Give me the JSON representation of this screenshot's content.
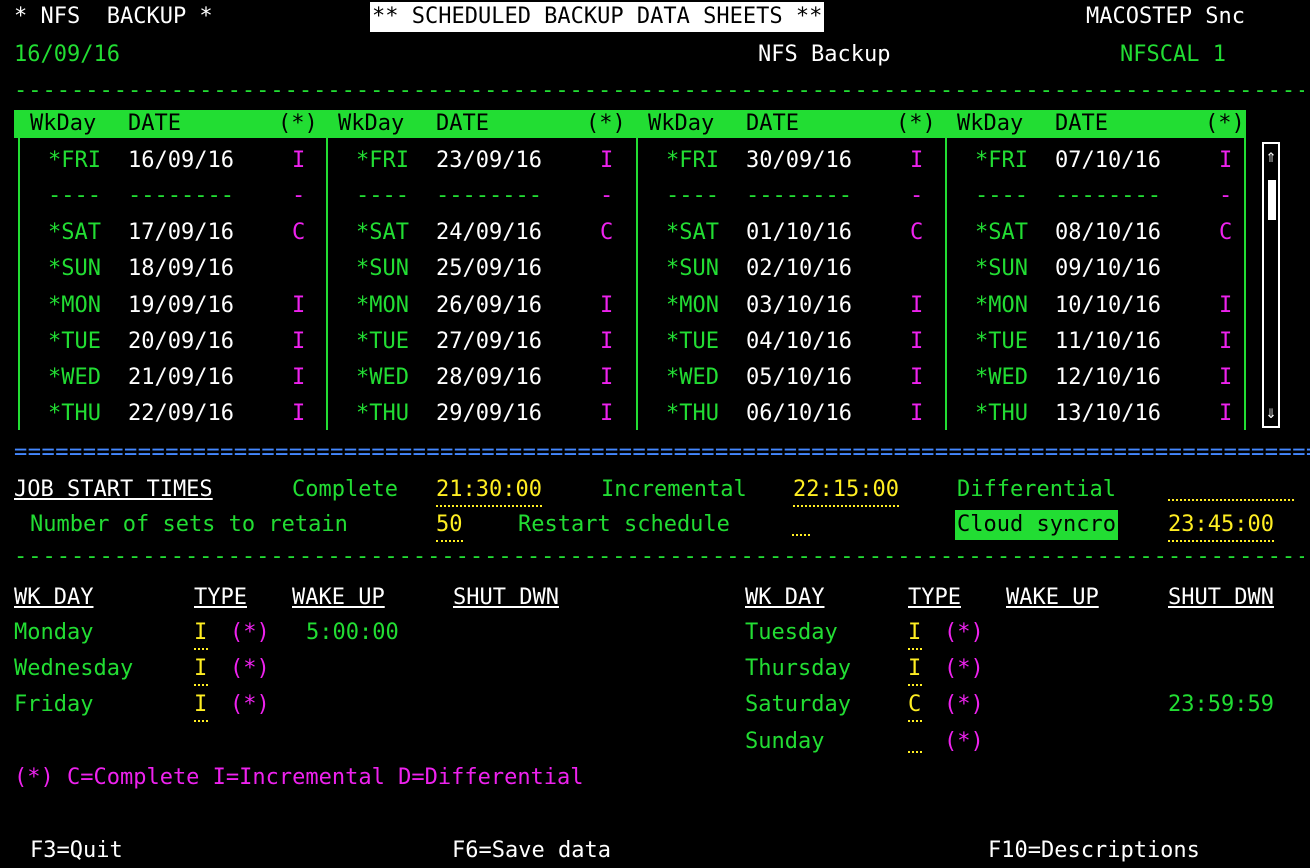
{
  "header": {
    "left": "* NFS  BACKUP *",
    "title": "** SCHEDULED BACKUP DATA SHEETS **",
    "right": "MACOSTEP Snc",
    "date": "16/09/16",
    "subtitle": "NFS Backup",
    "code": "NFSCAL 1"
  },
  "calendar": {
    "col_wkday": "WkDay",
    "col_date": "DATE",
    "col_flag": "(*)",
    "columns": [
      [
        {
          "day": "*FRI",
          "date": "16/09/16",
          "flag": "I"
        },
        {
          "day": "----",
          "date": "--------",
          "flag": "-"
        },
        {
          "day": "*SAT",
          "date": "17/09/16",
          "flag": "C"
        },
        {
          "day": "*SUN",
          "date": "18/09/16",
          "flag": ""
        },
        {
          "day": "*MON",
          "date": "19/09/16",
          "flag": "I"
        },
        {
          "day": "*TUE",
          "date": "20/09/16",
          "flag": "I"
        },
        {
          "day": "*WED",
          "date": "21/09/16",
          "flag": "I"
        },
        {
          "day": "*THU",
          "date": "22/09/16",
          "flag": "I"
        }
      ],
      [
        {
          "day": "*FRI",
          "date": "23/09/16",
          "flag": "I"
        },
        {
          "day": "----",
          "date": "--------",
          "flag": "-"
        },
        {
          "day": "*SAT",
          "date": "24/09/16",
          "flag": "C"
        },
        {
          "day": "*SUN",
          "date": "25/09/16",
          "flag": ""
        },
        {
          "day": "*MON",
          "date": "26/09/16",
          "flag": "I"
        },
        {
          "day": "*TUE",
          "date": "27/09/16",
          "flag": "I"
        },
        {
          "day": "*WED",
          "date": "28/09/16",
          "flag": "I"
        },
        {
          "day": "*THU",
          "date": "29/09/16",
          "flag": "I"
        }
      ],
      [
        {
          "day": "*FRI",
          "date": "30/09/16",
          "flag": "I"
        },
        {
          "day": "----",
          "date": "--------",
          "flag": "-"
        },
        {
          "day": "*SAT",
          "date": "01/10/16",
          "flag": "C"
        },
        {
          "day": "*SUN",
          "date": "02/10/16",
          "flag": ""
        },
        {
          "day": "*MON",
          "date": "03/10/16",
          "flag": "I"
        },
        {
          "day": "*TUE",
          "date": "04/10/16",
          "flag": "I"
        },
        {
          "day": "*WED",
          "date": "05/10/16",
          "flag": "I"
        },
        {
          "day": "*THU",
          "date": "06/10/16",
          "flag": "I"
        }
      ],
      [
        {
          "day": "*FRI",
          "date": "07/10/16",
          "flag": "I"
        },
        {
          "day": "----",
          "date": "--------",
          "flag": "-"
        },
        {
          "day": "*SAT",
          "date": "08/10/16",
          "flag": "C"
        },
        {
          "day": "*SUN",
          "date": "09/10/16",
          "flag": ""
        },
        {
          "day": "*MON",
          "date": "10/10/16",
          "flag": "I"
        },
        {
          "day": "*TUE",
          "date": "11/10/16",
          "flag": "I"
        },
        {
          "day": "*WED",
          "date": "12/10/16",
          "flag": "I"
        },
        {
          "day": "*THU",
          "date": "13/10/16",
          "flag": "I"
        }
      ]
    ]
  },
  "job": {
    "label": "JOB START TIMES",
    "complete_label": "Complete",
    "complete_value": "21:30:00",
    "incremental_label": "Incremental",
    "incremental_value": "22:15:00",
    "differential_label": "Differential",
    "differential_value": "",
    "retain_label": "Number of sets to retain",
    "retain_value": "50",
    "restart_label": "Restart schedule",
    "restart_value": "",
    "cloud_label": "Cloud syncro",
    "cloud_value": "23:45:00"
  },
  "weekly": {
    "col_day": "WK DAY",
    "col_type": "TYPE",
    "col_wake": "WAKE UP",
    "col_shut": "SHUT DWN",
    "left": [
      {
        "day": "Monday",
        "type": "I",
        "flag": "(*)",
        "wake": "5:00:00",
        "shut": ""
      },
      {
        "day": "Wednesday",
        "type": "I",
        "flag": "(*)",
        "wake": "",
        "shut": ""
      },
      {
        "day": "Friday",
        "type": "I",
        "flag": "(*)",
        "wake": "",
        "shut": ""
      }
    ],
    "right": [
      {
        "day": "Tuesday",
        "type": "I",
        "flag": "(*)",
        "wake": "",
        "shut": ""
      },
      {
        "day": "Thursday",
        "type": "I",
        "flag": "(*)",
        "wake": "",
        "shut": ""
      },
      {
        "day": "Saturday",
        "type": "C",
        "flag": "(*)",
        "wake": "",
        "shut": "23:59:59"
      },
      {
        "day": "Sunday",
        "type": "",
        "flag": "(*)",
        "wake": "",
        "shut": ""
      }
    ]
  },
  "legend": "(*) C=Complete I=Incremental D=Differential",
  "fkeys": {
    "quit": "F3=Quit",
    "save": "F6=Save data",
    "desc": "F10=Descriptions"
  },
  "colors": {
    "green": "#22dd33",
    "magenta": "#ee22ee",
    "yellow": "#ffee22",
    "blue": "#4488ff"
  }
}
